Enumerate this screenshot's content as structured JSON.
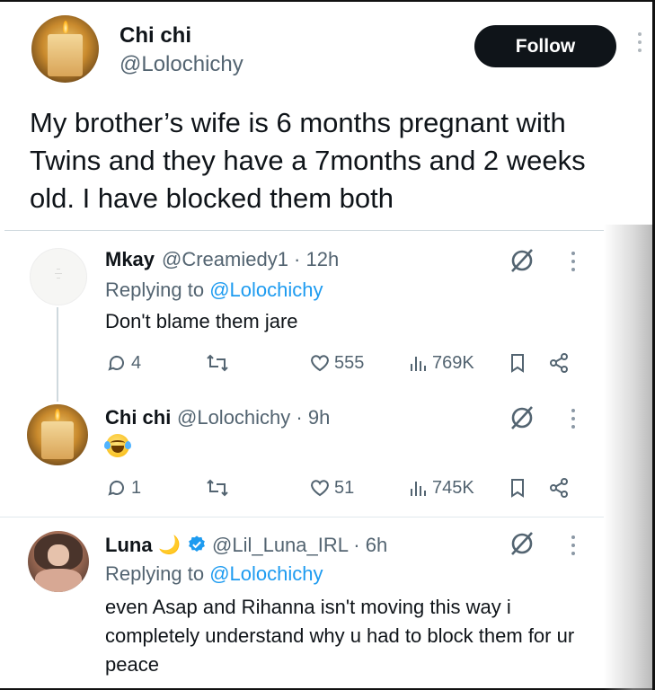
{
  "main_tweet": {
    "name": "Chi chi",
    "handle": "@Lolochichy",
    "follow_label": "Follow",
    "text": "My brother’s wife is 6 months pregnant with Twins and they have a 7months and 2 weeks old. I have blocked them both"
  },
  "replies": [
    {
      "name": "Mkay",
      "meta": "@Creamiedy1 · 12h",
      "replying_prefix": "Replying to ",
      "replying_mention": "@Lolochichy",
      "text": "Don't blame them jare",
      "stats": {
        "replies": "4",
        "retweets": "",
        "likes": "555",
        "views": "769K"
      }
    },
    {
      "name": "Chi chi",
      "meta": "@Lolochichy · 9h",
      "text_emoji": "face-with-tears-of-joy",
      "stats": {
        "replies": "1",
        "retweets": "",
        "likes": "51",
        "views": "745K"
      }
    },
    {
      "name": "Luna",
      "name_emoji": "🌙",
      "meta": "@Lil_Luna_IRL · 6h",
      "replying_prefix": "Replying to ",
      "replying_mention": "@Lolochichy",
      "text": "even Asap and Rihanna isn't moving this way i completely understand why u had to block them for ur peace"
    }
  ],
  "colors": {
    "text": "#0f1419",
    "secondary": "#536471",
    "link": "#1d9bf0",
    "verified": "#1d9bf0",
    "follow_bg": "#0f1419"
  }
}
